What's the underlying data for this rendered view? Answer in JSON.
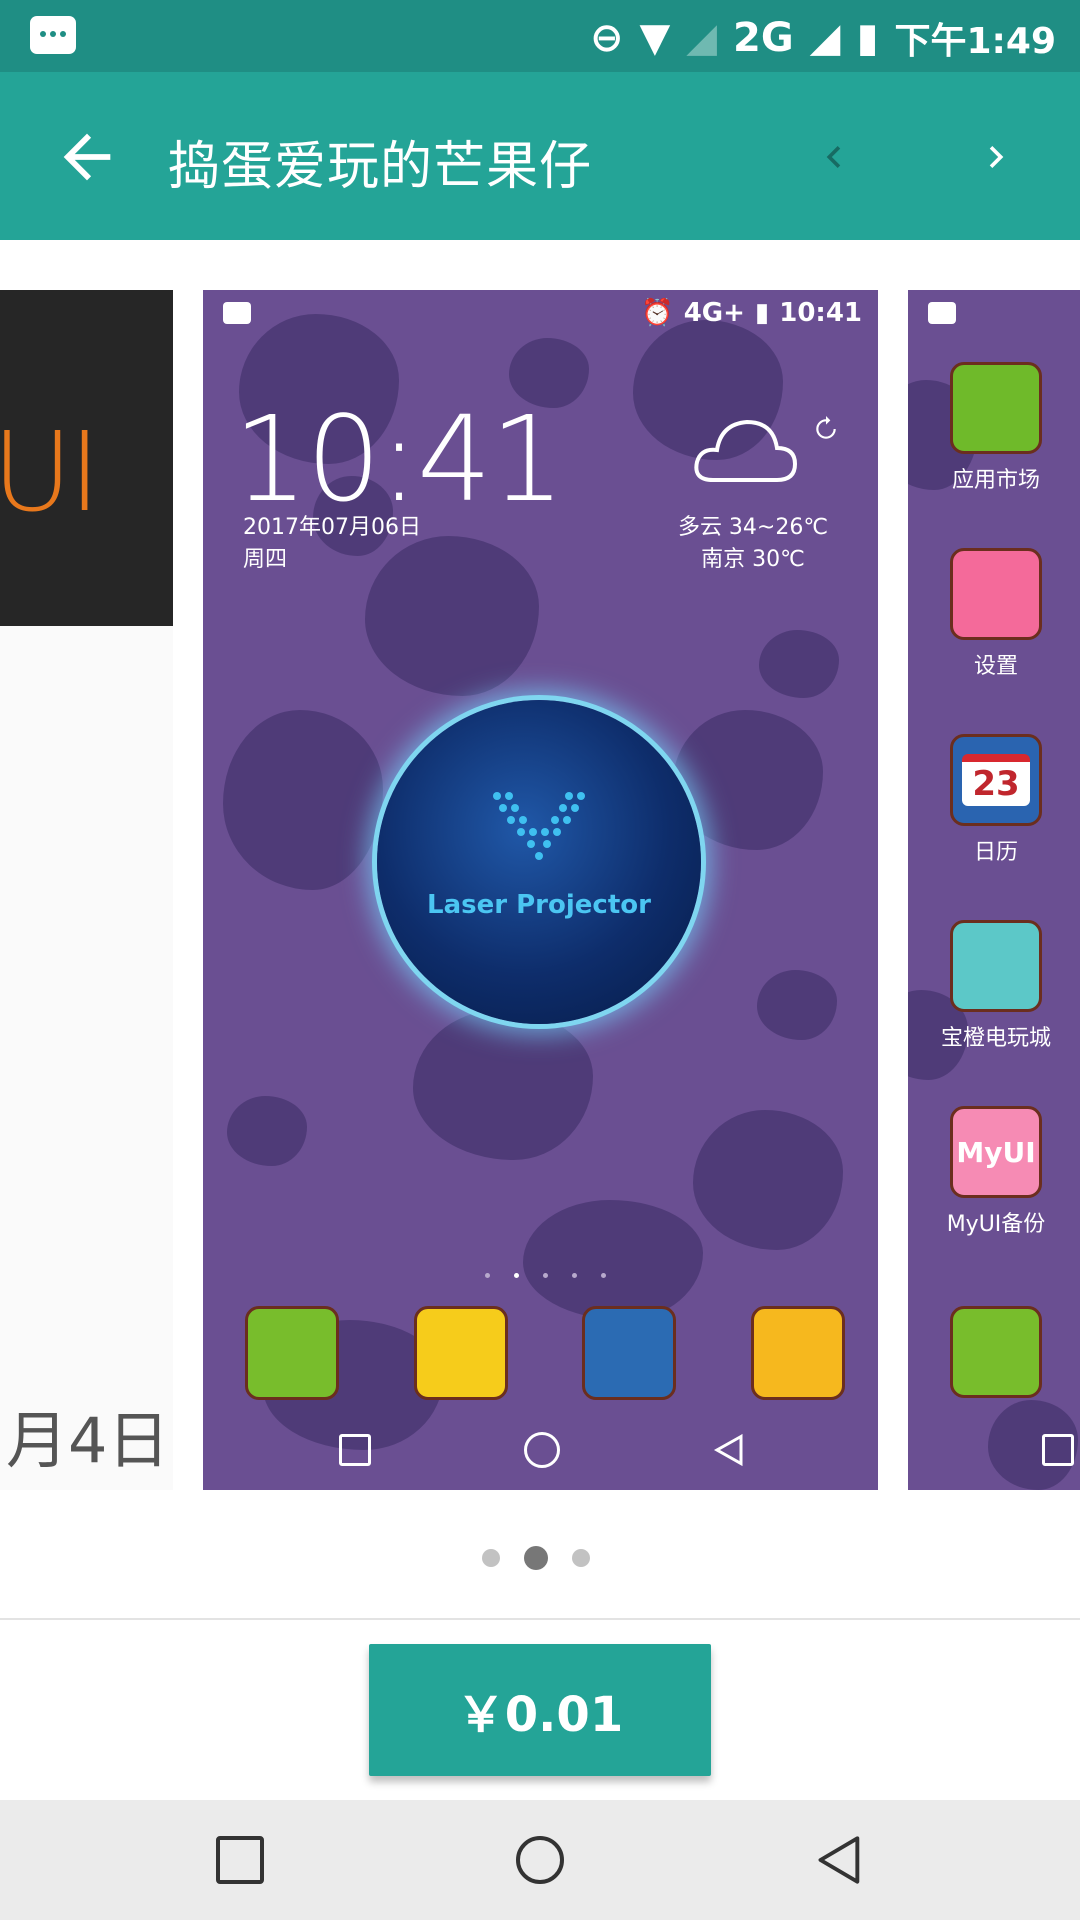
{
  "status_bar": {
    "time": "下午1:49",
    "network": "2G"
  },
  "app_bar": {
    "title": "捣蛋爱玩的芒果仔"
  },
  "left_preview": {
    "brand_text": "UI",
    "date_text": "月4日"
  },
  "preview": {
    "status_time": "10:41",
    "status_network": "4G+",
    "clock": "10:41",
    "date": "2017年07月06日",
    "weekday": "周四",
    "weather_line1": "多云 34~26℃",
    "weather_line2": "南京 30℃",
    "center_widget_text": "Laser Projector"
  },
  "right_preview": {
    "apps": [
      {
        "label": "应用市场"
      },
      {
        "label": "设置"
      },
      {
        "label": "日历",
        "icon_text": "23"
      },
      {
        "label": "宝橙电玩城"
      },
      {
        "label": "MyUI备份",
        "icon_text": "MyUI"
      }
    ]
  },
  "pager": {
    "count": 3,
    "active": 2
  },
  "purchase": {
    "price_label": "￥0.01"
  },
  "colors": {
    "primary": "#24a497",
    "status_bar": "#1f8e84",
    "preview_bg": "#6a4f92"
  }
}
